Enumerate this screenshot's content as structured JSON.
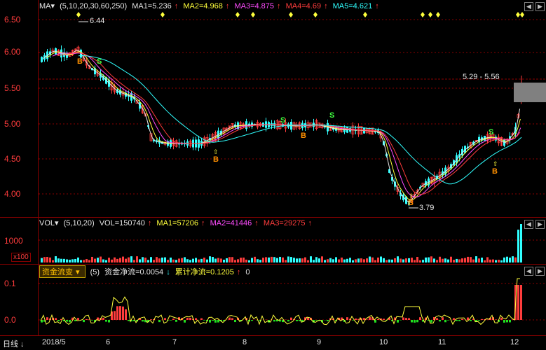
{
  "price_panel": {
    "indicator_menu": "MA▾",
    "params": "(5,10,20,30,60,250)",
    "ma": [
      {
        "label": "MA1=5.236",
        "color": "#e6e6e6"
      },
      {
        "label": "MA2=4.968",
        "color": "#ffff3c"
      },
      {
        "label": "MA3=4.875",
        "color": "#ff4cff"
      },
      {
        "label": "MA4=4.69",
        "color": "#ff3c3c"
      },
      {
        "label": "MA5=4.621",
        "color": "#30ffff"
      }
    ],
    "y_ticks": [
      "6.50",
      "6.00",
      "5.50",
      "5.00",
      "4.50",
      "4.00"
    ],
    "high_label": "6.44",
    "low_label": "3.79",
    "range_label": "5.29 - 5.56",
    "buy_marker": "B",
    "sell_marker": "S"
  },
  "volume_panel": {
    "indicator_menu": "VOL▾",
    "params": "(5,10,20)",
    "values": [
      {
        "label": "VOL=150740",
        "color": "#e6e6e6"
      },
      {
        "label": "MA1=57206",
        "color": "#ffff3c"
      },
      {
        "label": "MA2=41446",
        "color": "#ff4cff"
      },
      {
        "label": "MA3=29275",
        "color": "#ff3c3c"
      }
    ],
    "y_tick": "1000",
    "unit": "x100"
  },
  "fund_panel": {
    "indicator_menu": "资金流变",
    "params": "(5)",
    "net_flow": "资金净流=0.0054",
    "cumulative": "累计净流=0.1205",
    "trailing": "0",
    "y_ticks": [
      "0.1",
      "0.0"
    ]
  },
  "bottom": {
    "period_label": "日线",
    "months": [
      "2018/5",
      "6",
      "7",
      "8",
      "9",
      "10",
      "11",
      "12"
    ]
  },
  "colors": {
    "background": "#000000",
    "grid": "#8a0000",
    "up": "#ff3c3c",
    "down": "#30ffff",
    "marker_b": "#ff9000",
    "marker_s": "#40ff40"
  }
}
